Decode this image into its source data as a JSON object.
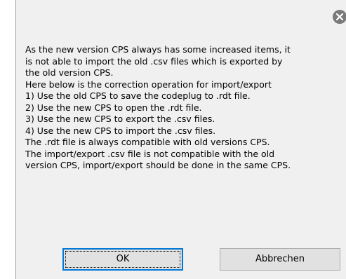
{
  "dialog": {
    "message_lines": [
      "As the new version CPS always has some increased items, it",
      "is not able to import the old .csv files which is exported by",
      "the old version CPS.",
      "Here below is the correction operation for import/export",
      "1) Use the old CPS to save the codeplug to .rdt file.",
      "2) Use the new CPS to open the .rdt file.",
      "3) Use the new CPS to export the .csv files.",
      "4) Use the new CPS to import the .csv files.",
      "The .rdt file is always compatible with old versions CPS.",
      "The import/export .csv file is not compatible with the old",
      "version CPS, import/export should be done in the same CPS."
    ],
    "buttons": {
      "ok_label": "OK",
      "cancel_label": "Abbrechen"
    },
    "close_icon": "close-icon"
  }
}
